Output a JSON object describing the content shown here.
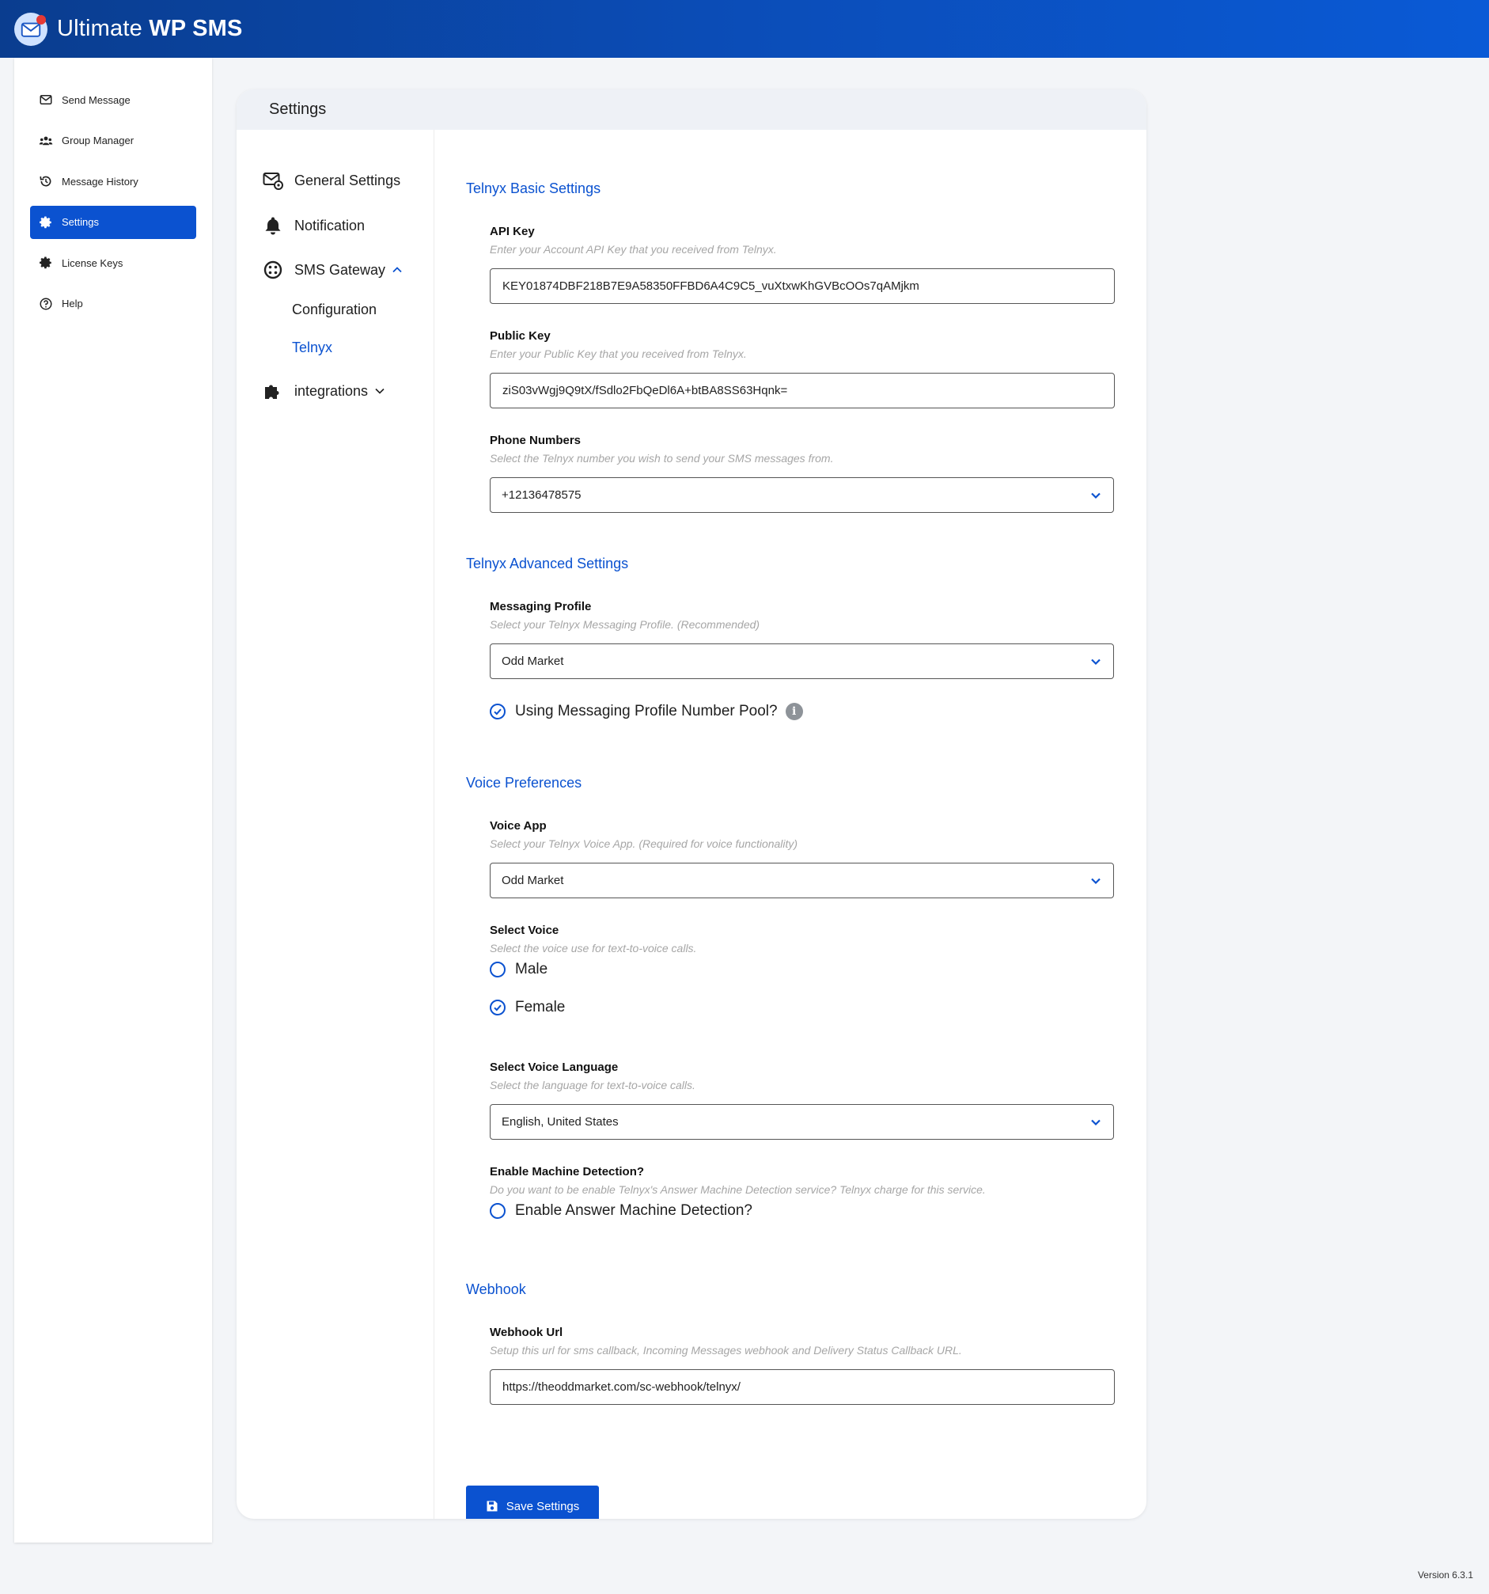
{
  "header": {
    "brand_regular": "Ultimate ",
    "brand_bold": "WP SMS"
  },
  "sidebar": {
    "items": [
      {
        "label": "Send Message",
        "icon": "envelope-icon"
      },
      {
        "label": "Group Manager",
        "icon": "users-icon"
      },
      {
        "label": "Message History",
        "icon": "history-icon"
      },
      {
        "label": "Settings",
        "icon": "gear-icon",
        "active": true
      },
      {
        "label": "License Keys",
        "icon": "gear-icon"
      },
      {
        "label": "Help",
        "icon": "help-icon"
      }
    ]
  },
  "card": {
    "title": "Settings",
    "subnav": {
      "general": "General Settings",
      "notification": "Notification",
      "sms_gateway": "SMS Gateway",
      "configuration": "Configuration",
      "telnyx": "Telnyx",
      "integrations": "integrations"
    }
  },
  "form": {
    "basic": {
      "title": "Telnyx Basic Settings",
      "api_key_label": "API Key",
      "api_key_hint": "Enter your Account API Key that you received from Telnyx.",
      "api_key_value": "KEY01874DBF218B7E9A58350FFBD6A4C9C5_vuXtxwKhGVBcOOs7qAMjkm",
      "public_key_label": "Public Key",
      "public_key_hint": "Enter your Public Key that you received from Telnyx.",
      "public_key_value": "ziS03vWgj9Q9tX/fSdlo2FbQeDl6A+btBA8SS63Hqnk=",
      "phone_label": "Phone Numbers",
      "phone_hint": "Select the Telnyx number you wish to send your SMS messages from.",
      "phone_value": "+12136478575"
    },
    "advanced": {
      "title": "Telnyx Advanced Settings",
      "profile_label": "Messaging Profile",
      "profile_hint": "Select your Telnyx Messaging Profile. (Recommended)",
      "profile_value": "Odd Market",
      "pool_label": "Using Messaging Profile Number Pool?",
      "pool_checked": true
    },
    "voice": {
      "title": "Voice Preferences",
      "app_label": "Voice App",
      "app_hint": "Select your Telnyx Voice App. (Required for voice functionality)",
      "app_value": "Odd Market",
      "voice_label": "Select Voice",
      "voice_hint": "Select the voice use for text-to-voice calls.",
      "male": "Male",
      "female": "Female",
      "selected_voice": "Female",
      "lang_label": "Select Voice Language",
      "lang_hint": "Select the language for text-to-voice calls.",
      "lang_value": "English, United States",
      "amd_label": "Enable Machine Detection?",
      "amd_hint": "Do you want to be enable Telnyx's Answer Machine Detection service? Telnyx charge for this service.",
      "amd_option": "Enable Answer Machine Detection?",
      "amd_checked": false
    },
    "webhook": {
      "title": "Webhook",
      "url_label": "Webhook Url",
      "url_hint": "Setup this url for sms callback, Incoming Messages webhook and Delivery Status Callback URL.",
      "url_value": "https://theoddmarket.com/sc-webhook/telnyx/"
    },
    "save_label": "Save Settings"
  },
  "footer": {
    "version": "Version 6.3.1"
  },
  "colors": {
    "accent": "#0b52d0",
    "header_start": "#0a3d8f",
    "header_end": "#0a5ad6"
  }
}
